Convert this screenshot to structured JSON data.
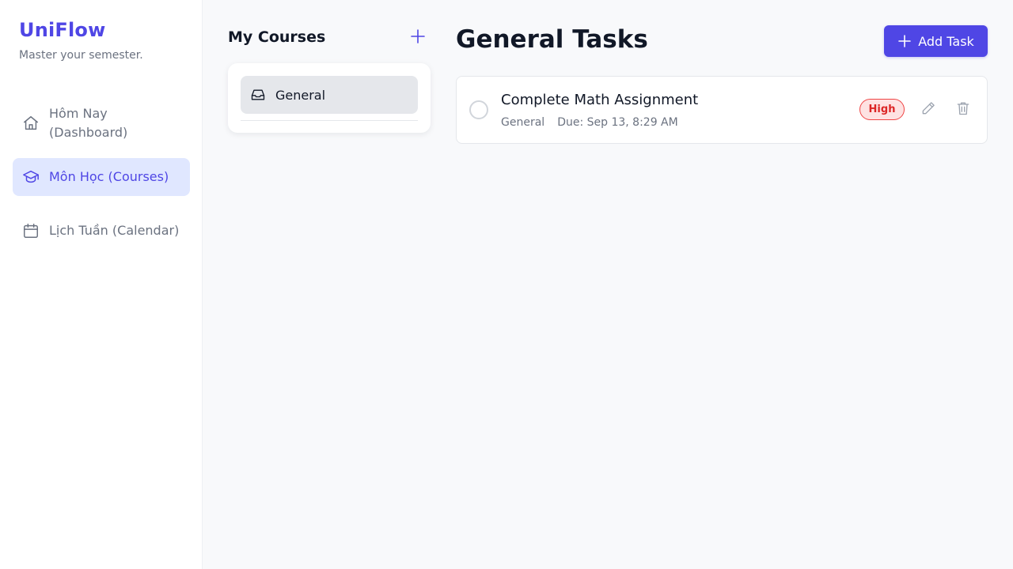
{
  "app": {
    "brand": "UniFlow",
    "tagline": "Master your semester."
  },
  "sidebar": {
    "items": [
      {
        "label": "Hôm Nay (Dashboard)",
        "icon": "home-icon",
        "active": false
      },
      {
        "label": "Môn Học (Courses)",
        "icon": "graduation-cap-icon",
        "active": true
      },
      {
        "label": "Lịch Tuần (Calendar)",
        "icon": "calendar-icon",
        "active": false
      }
    ]
  },
  "courses": {
    "title": "My Courses",
    "add_icon": "plus-icon",
    "items": [
      {
        "label": "General",
        "icon": "inbox-icon",
        "selected": true
      }
    ]
  },
  "main": {
    "title": "General Tasks",
    "add_task_label": "Add Task",
    "add_task_icon": "plus-icon",
    "tasks": [
      {
        "title": "Complete Math Assignment",
        "course": "General",
        "due": "Due: Sep 13, 8:29 AM",
        "priority": "High",
        "completed": false
      }
    ]
  },
  "colors": {
    "accent": "#4f46e5",
    "accent_light": "#e0e7ff",
    "priority_high": "#dc2626",
    "priority_high_bg": "#fee2e2",
    "muted_text": "#6b7280"
  }
}
